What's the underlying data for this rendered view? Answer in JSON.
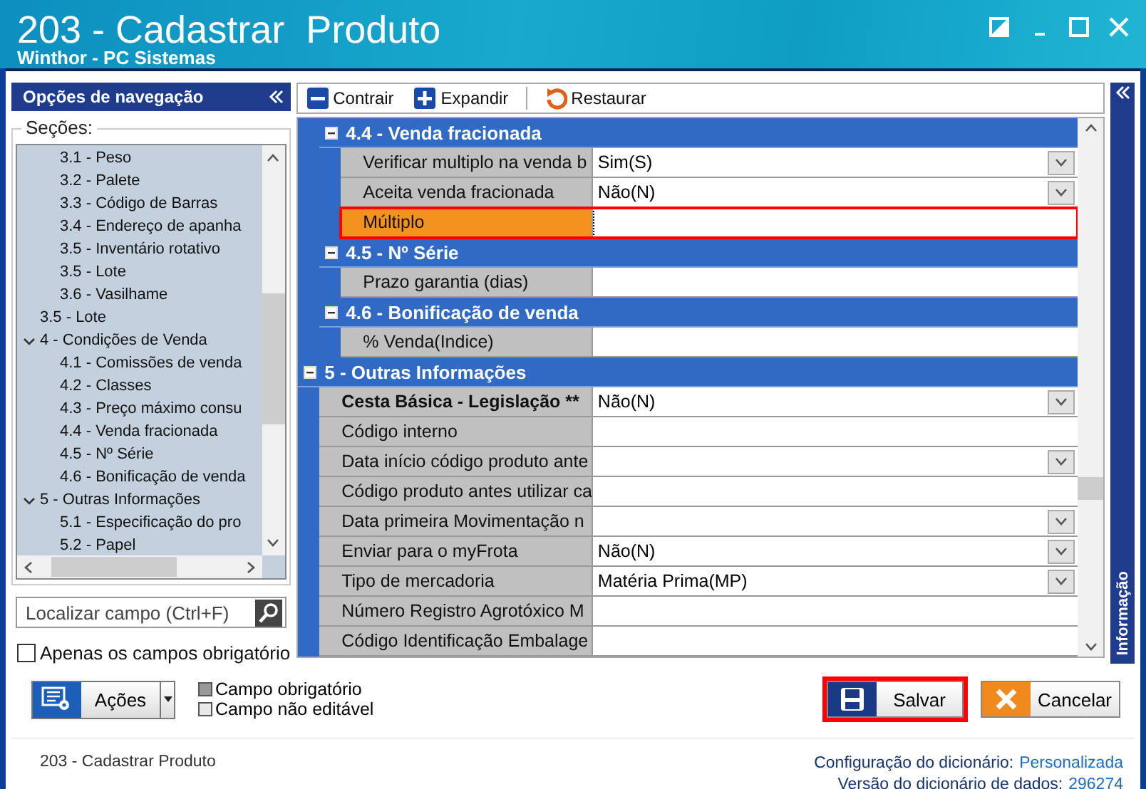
{
  "window": {
    "title": "203 - Cadastrar  Produto",
    "subtitle": "Winthor - PC Sistemas"
  },
  "navigation": {
    "title": "Opções de navegação",
    "sections_label": "Seções:",
    "tree": [
      {
        "children": [
          {
            "label": "3.1 - Peso"
          },
          {
            "label": "3.2 - Palete"
          },
          {
            "label": "3.3 - Código de Barras"
          },
          {
            "label": "3.4 - Endereço de apanha"
          },
          {
            "label": "3.5 - Inventário rotativo"
          },
          {
            "label": "3.5 - Lote"
          },
          {
            "label": "3.6 - Vasilhame"
          }
        ]
      },
      {
        "label": "3.5 - Lote"
      },
      {
        "label": "4 - Condições de Venda",
        "expanded": true,
        "children": [
          {
            "label": "4.1 - Comissões de venda"
          },
          {
            "label": "4.2 - Classes"
          },
          {
            "label": "4.3 - Preço máximo consu"
          },
          {
            "label": "4.4 - Venda fracionada"
          },
          {
            "label": "4.5 - Nº Série"
          },
          {
            "label": "4.6 - Bonificação de venda"
          }
        ]
      },
      {
        "label": "5 - Outras Informações",
        "expanded": true,
        "children": [
          {
            "label": "5.1 - Especificação do pro"
          },
          {
            "label": "5.2 - Papel"
          }
        ]
      }
    ],
    "search": {
      "placeholder": "Localizar campo (Ctrl+F)"
    },
    "required_only": {
      "label": "Apenas os campos obrigatório",
      "checked": false
    }
  },
  "toolbar": [
    {
      "kind": "collapse",
      "label": "Contrair"
    },
    {
      "kind": "expand",
      "label": "Expandir"
    },
    {
      "kind": "restore",
      "label": "Restaurar"
    }
  ],
  "grid": [
    {
      "children": [
        {
          "title": "4.4 - Venda fracionada",
          "expanded": true,
          "fields": [
            {
              "label": "Verificar multiplo na venda b",
              "value": "Sim(S)",
              "dropdown": true,
              "required": false,
              "highlighted": false
            },
            {
              "label": "Aceita venda fracionada",
              "value": "Não(N)",
              "dropdown": true,
              "required": false,
              "highlighted": false
            },
            {
              "label": "Múltiplo",
              "dropdown": false,
              "required": false,
              "highlighted": true
            }
          ]
        },
        {
          "title": "4.5 - Nº Série",
          "expanded": true,
          "fields": [
            {
              "label": "Prazo garantia (dias)",
              "dropdown": false,
              "required": false,
              "highlighted": false
            }
          ]
        },
        {
          "title": "4.6 - Bonificação de venda",
          "expanded": true,
          "fields": [
            {
              "label": "% Venda(Indice)",
              "dropdown": false,
              "required": false,
              "highlighted": false
            }
          ]
        }
      ]
    },
    {
      "title": "5 - Outras Informações",
      "expanded": true,
      "fields": [
        {
          "label": "Cesta Básica - Legislação **",
          "value": "Não(N)",
          "dropdown": true,
          "required": true,
          "highlighted": false
        },
        {
          "label": "Código interno",
          "dropdown": false,
          "required": false,
          "highlighted": false
        },
        {
          "label": "Data início código produto ante",
          "dropdown": true,
          "required": false,
          "highlighted": false
        },
        {
          "label": "Código produto antes utilizar ca",
          "dropdown": false,
          "required": false,
          "highlighted": false
        },
        {
          "label": "Data primeira Movimentação n",
          "dropdown": true,
          "required": false,
          "highlighted": false
        },
        {
          "label": "Enviar para o myFrota",
          "value": "Não(N)",
          "dropdown": true,
          "required": false,
          "highlighted": false
        },
        {
          "label": "Tipo de mercadoria",
          "value": "Matéria Prima(MP)",
          "dropdown": true,
          "required": false,
          "highlighted": false
        },
        {
          "label": "Número Registro Agrotóxico M",
          "dropdown": false,
          "required": false,
          "highlighted": false
        },
        {
          "label": "Código Identificação Embalage",
          "dropdown": false,
          "required": false,
          "highlighted": false
        }
      ]
    }
  ],
  "info_panel": {
    "title": "Informação"
  },
  "actions_button": {
    "label": "Ações"
  },
  "legend": [
    {
      "kind": "required",
      "label": "Campo obrigatório"
    },
    {
      "kind": "readonly",
      "label": "Campo não editável"
    }
  ],
  "buttons": [
    {
      "kind": "save",
      "label": "Salvar",
      "highlighted": true
    },
    {
      "kind": "cancel",
      "label": "Cancelar",
      "highlighted": false
    }
  ],
  "status_bar": {
    "left": "203 - Cadastrar  Produto",
    "config_label": "Configuração do dicionário:",
    "config_value": "Personalizada",
    "version_label": "Versão do dicionário de dados:",
    "version_value": "296274"
  }
}
